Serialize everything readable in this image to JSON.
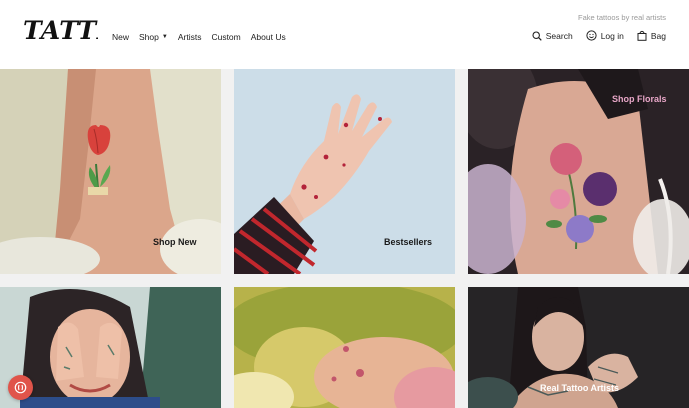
{
  "brand": {
    "logo_text": "TATTLY"
  },
  "header": {
    "tagline": "Fake tattoos by real artists",
    "nav": {
      "new": "New",
      "shop": "Shop",
      "artists": "Artists",
      "custom": "Custom",
      "about": "About Us"
    },
    "utility": {
      "search": "Search",
      "login": "Log in",
      "bag": "Bag"
    }
  },
  "tiles": {
    "shop_new": "Shop New",
    "bestsellers": "Bestsellers",
    "shop_florals": "Shop Florals",
    "real_tattoo_artists": "Real Tattoo Artists"
  },
  "colors": {
    "florals_label": "#e7a6c7",
    "chat_button": "#e0544a",
    "background": "#f1f1f1"
  },
  "icons": [
    "search-icon",
    "smiley-icon",
    "bag-icon",
    "chevron-down-icon",
    "chat-icon"
  ]
}
